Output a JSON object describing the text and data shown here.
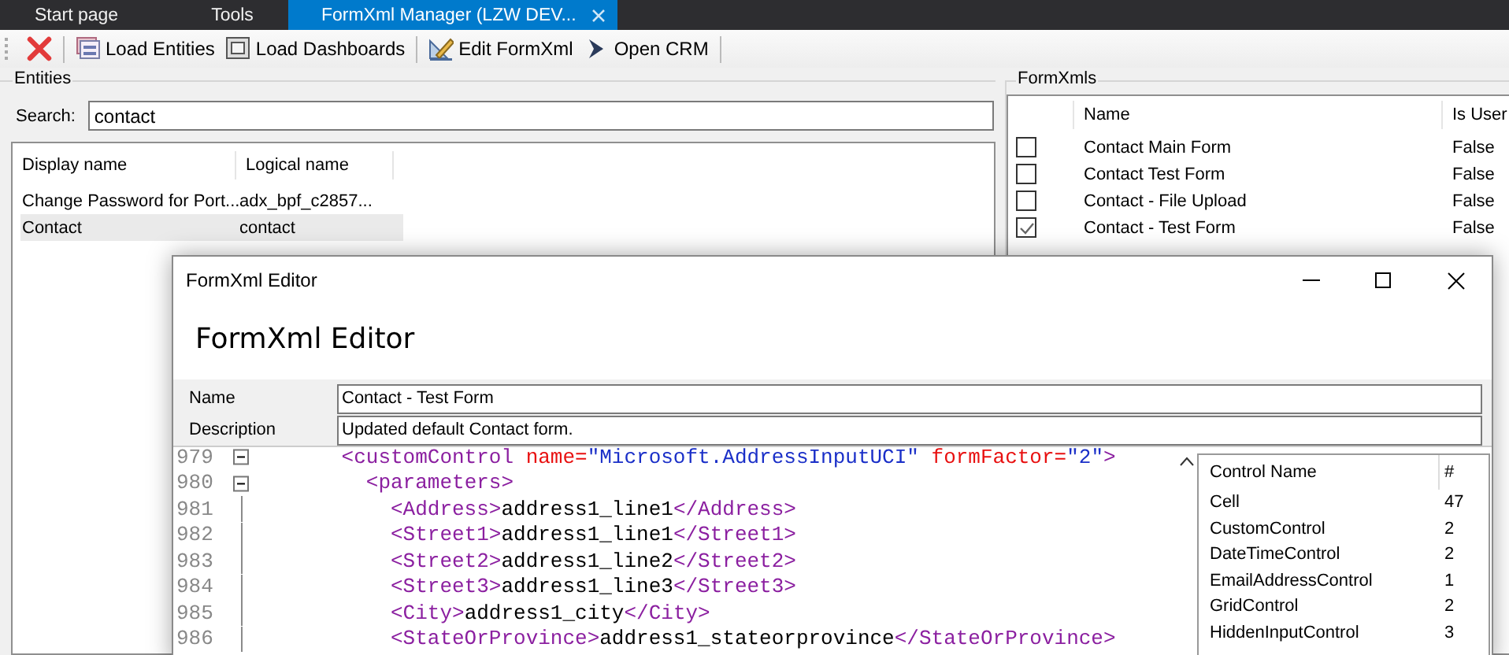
{
  "tabs": [
    {
      "label": "Start page",
      "selected": false,
      "closable": false
    },
    {
      "label": "Tools",
      "selected": false,
      "closable": false
    },
    {
      "label": "FormXml Manager (LZW DEV...",
      "selected": true,
      "closable": true
    }
  ],
  "toolbar": [
    {
      "kind": "delete"
    },
    {
      "kind": "separator"
    },
    {
      "kind": "entities",
      "label": "Load Entities"
    },
    {
      "kind": "dashboards",
      "label": "Load Dashboards"
    },
    {
      "kind": "separator"
    },
    {
      "kind": "edit",
      "label": "Edit FormXml"
    },
    {
      "kind": "open",
      "label": "Open CRM"
    },
    {
      "kind": "separator"
    }
  ],
  "entities": {
    "title": "Entities",
    "search_label": "Search:",
    "search_value": "contact",
    "columns": [
      "Display name",
      "Logical name"
    ],
    "rows": [
      {
        "cells": [
          "Change Password for Port...",
          "adx_bpf_c2857..."
        ],
        "selected": false
      },
      {
        "cells": [
          "Contact",
          "contact"
        ],
        "selected": true
      }
    ]
  },
  "formxmls": {
    "title": "FormXmls",
    "columns": [
      "Name",
      "Is User"
    ],
    "rows": [
      {
        "checked": false,
        "name": "Contact Main Form",
        "is_user": "False"
      },
      {
        "checked": false,
        "name": "Contact Test Form",
        "is_user": "False"
      },
      {
        "checked": false,
        "name": "Contact - File Upload",
        "is_user": "False"
      },
      {
        "checked": true,
        "name": "Contact - Test Form",
        "is_user": "False"
      }
    ]
  },
  "editor": {
    "title": "FormXml Editor",
    "heading": "FormXml Editor",
    "fields": [
      {
        "label": "Name",
        "value": "Contact - Test Form"
      },
      {
        "label": "Description",
        "value": "Updated default Contact form."
      }
    ],
    "code_lines": [
      {
        "number": "979",
        "segments": [
          {
            "kind": "tag",
            "text": "<customControl"
          },
          {
            "kind": "attr",
            "text": " name="
          },
          {
            "kind": "value",
            "text": "\"Microsoft.AddressInputUCI\""
          },
          {
            "kind": "attr",
            "text": " formFactor="
          },
          {
            "kind": "value",
            "text": "\"2\""
          },
          {
            "kind": "tag",
            "text": ">"
          }
        ],
        "children": [
          {
            "number": "980",
            "segments": [
              {
                "kind": "tag",
                "text": "<parameters>"
              }
            ],
            "children": [
              {
                "number": "981",
                "segments": [
                  {
                    "kind": "tag",
                    "text": "<Address>"
                  },
                  {
                    "kind": "text",
                    "text": "address1_line1"
                  },
                  {
                    "kind": "tag",
                    "text": "</Address>"
                  }
                ]
              },
              {
                "number": "982",
                "segments": [
                  {
                    "kind": "tag",
                    "text": "<Street1>"
                  },
                  {
                    "kind": "text",
                    "text": "address1_line1"
                  },
                  {
                    "kind": "tag",
                    "text": "</Street1>"
                  }
                ]
              },
              {
                "number": "983",
                "segments": [
                  {
                    "kind": "tag",
                    "text": "<Street2>"
                  },
                  {
                    "kind": "text",
                    "text": "address1_line2"
                  },
                  {
                    "kind": "tag",
                    "text": "</Street2>"
                  }
                ]
              },
              {
                "number": "984",
                "segments": [
                  {
                    "kind": "tag",
                    "text": "<Street3>"
                  },
                  {
                    "kind": "text",
                    "text": "address1_line3"
                  },
                  {
                    "kind": "tag",
                    "text": "</Street3>"
                  }
                ]
              },
              {
                "number": "985",
                "segments": [
                  {
                    "kind": "tag",
                    "text": "<City>"
                  },
                  {
                    "kind": "text",
                    "text": "address1_city"
                  },
                  {
                    "kind": "tag",
                    "text": "</City>"
                  }
                ]
              },
              {
                "number": "986",
                "segments": [
                  {
                    "kind": "tag",
                    "text": "<StateOrProvince>"
                  },
                  {
                    "kind": "text",
                    "text": "address1_stateorprovince"
                  },
                  {
                    "kind": "tag",
                    "text": "</StateOrProvince>"
                  }
                ]
              }
            ]
          }
        ]
      }
    ],
    "controls": {
      "columns": [
        "Control Name",
        "#"
      ],
      "rows": [
        [
          "Cell",
          "47"
        ],
        [
          "CustomControl",
          "2"
        ],
        [
          "DateTimeControl",
          "2"
        ],
        [
          "EmailAddressControl",
          "1"
        ],
        [
          "GridControl",
          "2"
        ],
        [
          "HiddenInputControl",
          "3"
        ]
      ]
    }
  }
}
